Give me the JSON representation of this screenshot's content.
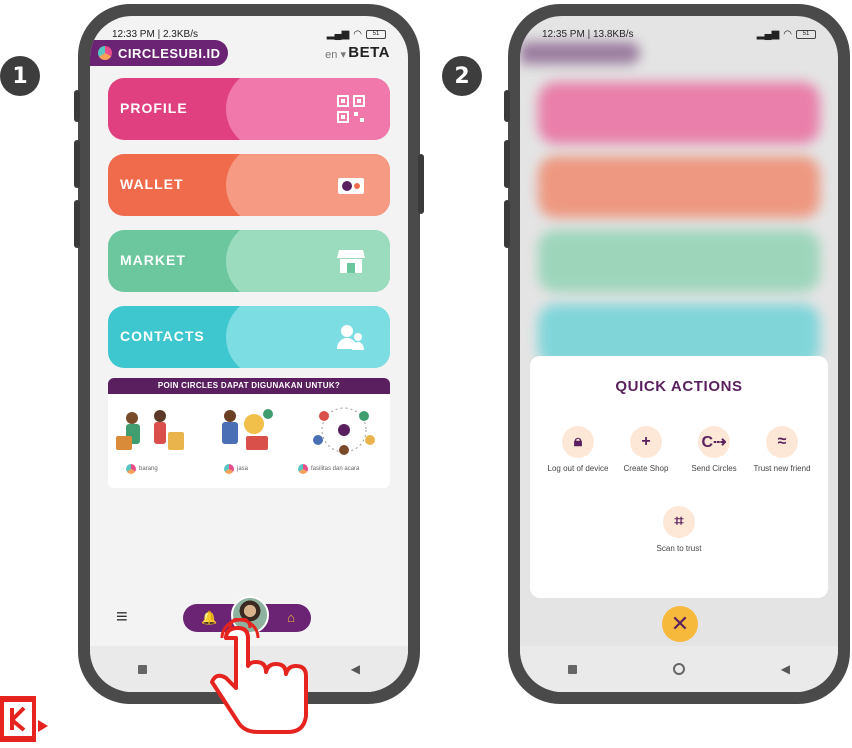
{
  "steps": [
    "1",
    "2"
  ],
  "colors": {
    "profile": "#e0407f",
    "profile_light": "#f178ab",
    "wallet": "#ef6b4c",
    "wallet_light": "#f79a83",
    "market": "#6cc79e",
    "market_light": "#9bdcbe",
    "contacts": "#3fc7cf",
    "contacts_light": "#7cdde2",
    "purple": "#6a2473",
    "accent": "#f6b93b"
  },
  "screen1": {
    "status": {
      "time": "12:33 PM | 2.3KB/s",
      "battery": "51"
    },
    "app": {
      "logo": "CIRCLESUBI.ID",
      "language": "en",
      "beta": "BETA"
    },
    "cards": [
      {
        "label": "PROFILE",
        "icon": "qr-code-icon"
      },
      {
        "label": "WALLET",
        "icon": "circles-coin-icon"
      },
      {
        "label": "MARKET",
        "icon": "shop-icon"
      },
      {
        "label": "CONTACTS",
        "icon": "people-icon"
      }
    ],
    "banner": {
      "title": "POIN CIRCLES DAPAT DIGUNAKAN UNTUK?",
      "captions": [
        "barang",
        "jasa",
        "fasilitas dan acara"
      ]
    },
    "bottom": {
      "menu": "≡",
      "bell": "🔔",
      "home": "⌂"
    }
  },
  "screen2": {
    "status": {
      "time": "12:35 PM | 13.8KB/s",
      "battery": "51"
    },
    "sheet": {
      "title": "QUICK ACTIONS",
      "actions": [
        {
          "label": "Log out of device",
          "icon": "lock-icon"
        },
        {
          "label": "Create Shop",
          "icon": "plus-icon"
        },
        {
          "label": "Send Circles",
          "icon": "send-coin-icon"
        },
        {
          "label": "Trust new friend",
          "icon": "trust-icon"
        },
        {
          "label": "Scan to trust",
          "icon": "scan-qr-icon"
        }
      ]
    },
    "close": "✕"
  }
}
